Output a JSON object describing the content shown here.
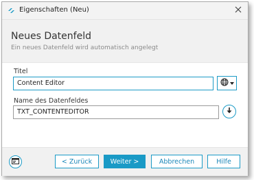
{
  "window": {
    "title": "Eigenschaften (Neu)"
  },
  "header": {
    "title": "Neues Datenfeld",
    "subtitle": "Ein neues Datenfeld wird automatisch angelegt"
  },
  "form": {
    "title_label": "Titel",
    "title_value": "Content Editor",
    "fieldname_label": "Name des Datenfeldes",
    "fieldname_value": "TXT_CONTENTEDITOR"
  },
  "footer": {
    "back_label": "< Zurück",
    "next_label": "Weiter >",
    "cancel_label": "Abbrechen",
    "help_label": "Hilfe"
  },
  "icons": {
    "app": "app-logo-icon",
    "close": "close-icon",
    "language": "globe-icon",
    "dropdown": "caret-down-icon",
    "download": "arrow-down-icon",
    "info": "window-info-icon"
  },
  "colors": {
    "accent": "#1a9ac6"
  }
}
